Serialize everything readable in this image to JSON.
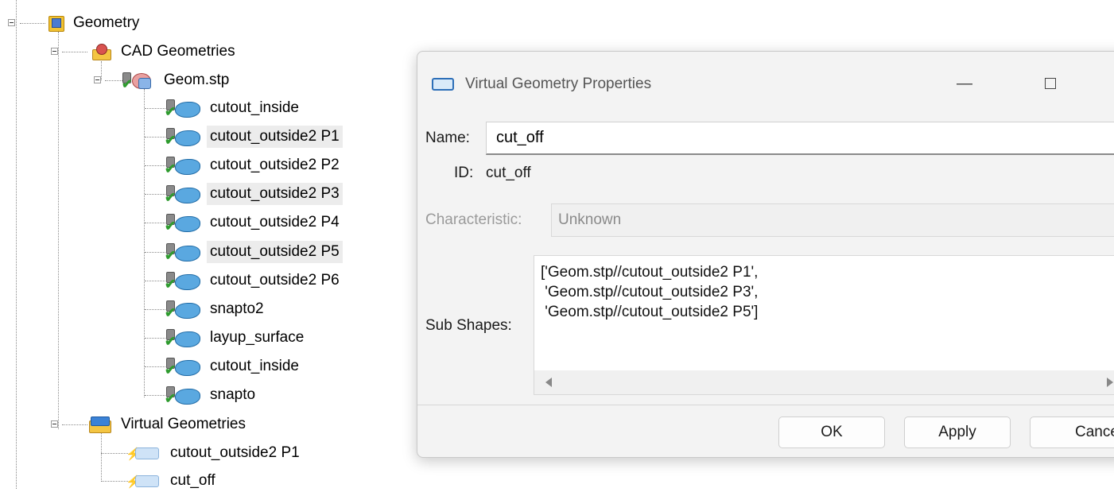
{
  "tree": {
    "geometry": "Geometry",
    "cad_geometries": "CAD Geometries",
    "file": "Geom.stp",
    "parts": [
      {
        "label": "cutout_inside",
        "selected": false
      },
      {
        "label": "cutout_outside2 P1",
        "selected": true
      },
      {
        "label": "cutout_outside2 P2",
        "selected": false
      },
      {
        "label": "cutout_outside2 P3",
        "selected": true
      },
      {
        "label": "cutout_outside2 P4",
        "selected": false
      },
      {
        "label": "cutout_outside2 P5",
        "selected": true
      },
      {
        "label": "cutout_outside2 P6",
        "selected": false
      },
      {
        "label": "snapto2",
        "selected": false
      },
      {
        "label": "layup_surface",
        "selected": false
      },
      {
        "label": "cutout_inside",
        "selected": false
      },
      {
        "label": "snapto",
        "selected": false
      }
    ],
    "virtual_geometries": "Virtual Geometries",
    "virtual_items": [
      "cutout_outside2 P1",
      "cut_off"
    ]
  },
  "dialog": {
    "title": "Virtual Geometry Properties",
    "minimize_glyph": "—",
    "close_glyph": "✕",
    "name_label": "Name:",
    "name_value": "cut_off",
    "id_label": "ID:",
    "id_value": "cut_off",
    "characteristic_label": "Characteristic:",
    "characteristic_value": "Unknown",
    "subshapes_label": "Sub Shapes:",
    "subshapes_value": "['Geom.stp//cutout_outside2 P1',\n 'Geom.stp//cutout_outside2 P3',\n 'Geom.stp//cutout_outside2 P5']",
    "ok_label": "OK",
    "apply_label": "Apply",
    "cancel_label": "Cancel"
  },
  "icons": {
    "geometry": "geometry-folder-icon",
    "cad": "cad-geometries-icon",
    "file": "step-file-icon",
    "part": "locked-surface-icon",
    "virtual_folder": "virtual-geometries-icon",
    "virtual_item": "virtual-surface-icon",
    "dialog": "virtual-geometry-icon"
  }
}
